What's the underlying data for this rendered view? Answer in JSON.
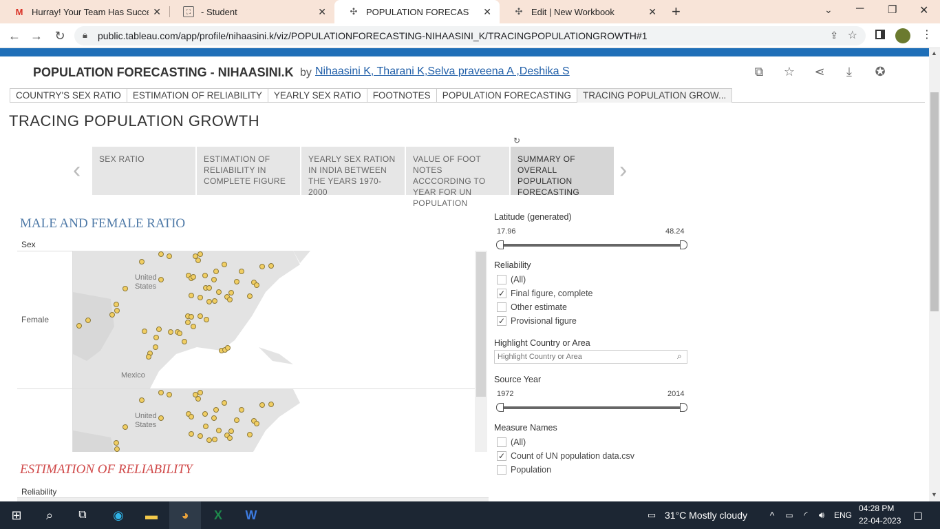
{
  "browser": {
    "tabs": [
      {
        "title": "Hurray! Your Team Has Successfu",
        "icon": "gmail-icon",
        "active": false
      },
      {
        "title": "- Student",
        "icon": "student-icon",
        "active": false
      },
      {
        "title": "POPULATION FORECASTING - NI",
        "icon": "tableau-icon",
        "active": true
      },
      {
        "title": "Edit | New Workbook",
        "icon": "tableau-icon",
        "active": false
      }
    ],
    "url": "public.tableau.com/app/profile/nihaasini.k/viz/POPULATIONFORECASTING-NIHAASINI_K/TRACINGPOPULATIONGROWTH#1"
  },
  "viz": {
    "title": "POPULATION FORECASTING - NIHAASINI.K",
    "by": "by",
    "authors": "Nihaasini K, Tharani K,Selva praveena A ,Deshika S",
    "sheet_tabs": [
      {
        "label": "COUNTRY'S SEX RATIO",
        "active": false
      },
      {
        "label": "ESTIMATION OF RELIABILITY",
        "active": false
      },
      {
        "label": "YEARLY SEX RATIO",
        "active": false
      },
      {
        "label": "FOOTNOTES",
        "active": false
      },
      {
        "label": "POPULATION FORECASTING",
        "active": false
      },
      {
        "label": "TRACING POPULATION GROW...",
        "active": true
      }
    ]
  },
  "story": {
    "title": "TRACING POPULATION GROWTH",
    "points": [
      {
        "label": "SEX RATIO",
        "active": false
      },
      {
        "label": "ESTIMATION OF RELIABILITY IN COMPLETE FIGURE",
        "active": false
      },
      {
        "label": "YEARLY SEX RATION IN INDIA BETWEEN THE YEARS 1970-2000",
        "active": false
      },
      {
        "label": "VALUE OF FOOT NOTES ACCCORDING TO YEAR FOR UN POPULATION",
        "active": false
      },
      {
        "label": "SUMMARY OF OVERALL POPULATION FORECASTING",
        "active": true
      }
    ]
  },
  "dashboard": {
    "section1": {
      "title": "MALE AND FEMALE RATIO",
      "color": "#4e79a7",
      "header": "Sex",
      "row_label": "Female"
    },
    "map_labels": {
      "united": "United",
      "states": "States",
      "mexico": "Mexico"
    },
    "section2": {
      "title": "ESTIMATION OF RELIABILITY",
      "color": "#d04a4a",
      "header": "Reliability"
    }
  },
  "filters": {
    "latitude": {
      "label": "Latitude (generated)",
      "min": "17.96",
      "max": "48.24"
    },
    "reliability": {
      "label": "Reliability",
      "options": [
        {
          "label": "(All)",
          "checked": false
        },
        {
          "label": "Final figure, complete",
          "checked": true
        },
        {
          "label": "Other estimate",
          "checked": false
        },
        {
          "label": "Provisional figure",
          "checked": true
        }
      ]
    },
    "highlight": {
      "label": "Highlight Country or Area",
      "placeholder": "Highlight Country or Area"
    },
    "source_year": {
      "label": "Source Year",
      "min": "1972",
      "max": "2014"
    },
    "measure_names": {
      "label": "Measure Names",
      "options": [
        {
          "label": "(All)",
          "checked": false
        },
        {
          "label": "Count of UN population data.csv",
          "checked": true
        },
        {
          "label": "Population",
          "checked": false
        }
      ]
    }
  },
  "taskbar": {
    "weather": "31°C  Mostly cloudy",
    "lang": "ENG",
    "time": "04:28 PM",
    "date": "22-04-2023"
  }
}
